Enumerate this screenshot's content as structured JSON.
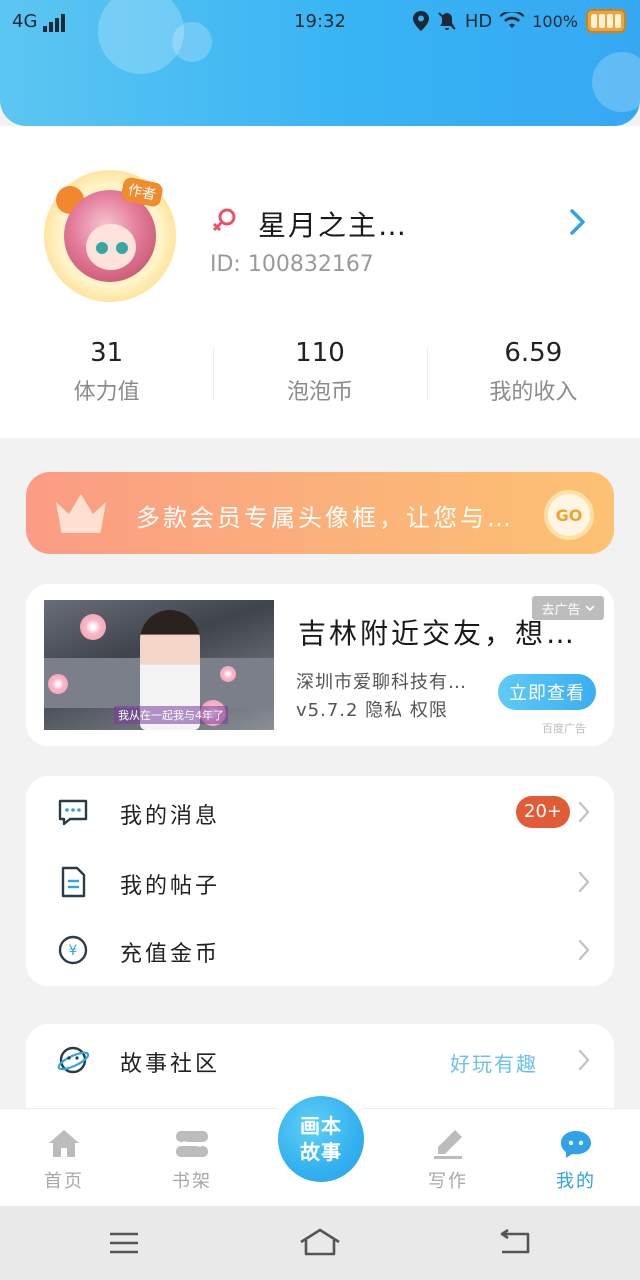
{
  "status_bar": {
    "network": "4G",
    "time": "19:32",
    "hd": "HD",
    "battery": "100%"
  },
  "profile": {
    "author_badge": "作者",
    "nickname": "星月之主…",
    "user_id": "ID: 100832167"
  },
  "stats": [
    {
      "value": "31",
      "label": "体力值"
    },
    {
      "value": "110",
      "label": "泡泡币"
    },
    {
      "value": "6.59",
      "label": "我的收入"
    }
  ],
  "vip_banner": {
    "text": "多款会员专属头像框，让您与…",
    "go": "GO"
  },
  "ad": {
    "tag": "去广告",
    "title": "吉林附近交友，想…",
    "company": "深圳市爱聊科技有…",
    "meta": "v5.7.2 隐私 权限",
    "cta": "立即查看",
    "source": "百度广告",
    "image_caption": "我从在一起我与4年了"
  },
  "menu": [
    {
      "label": "我的消息",
      "badge": "20+"
    },
    {
      "label": "我的帖子"
    },
    {
      "label": "充值金币"
    }
  ],
  "community": {
    "label": "故事社区",
    "hint": "好玩有趣"
  },
  "tabs": [
    {
      "label": "首页"
    },
    {
      "label": "书架"
    },
    {
      "label": "写作"
    },
    {
      "label": "我的"
    }
  ],
  "fab": {
    "line1": "画本",
    "line2": "故事"
  },
  "colors": {
    "accent": "#2fa3e6",
    "header": "#38b4f4",
    "vip_start": "#fb9c84",
    "vip_end": "#fdc272",
    "badge": "#e15c36"
  }
}
